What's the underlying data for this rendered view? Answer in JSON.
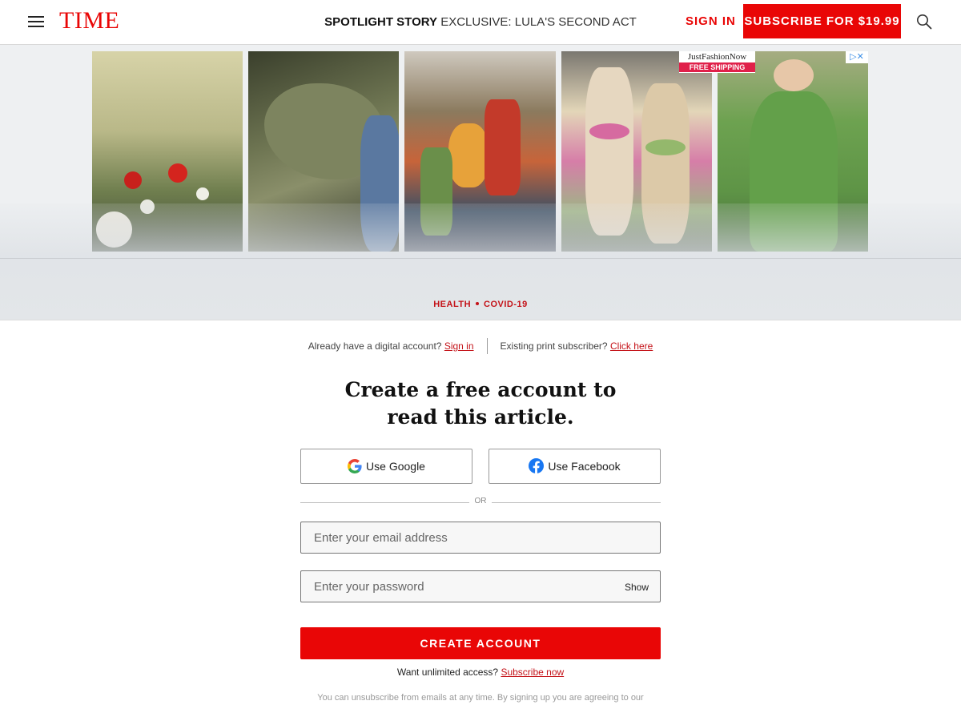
{
  "header": {
    "logo": "TIME",
    "spotlight_label": "SPOTLIGHT STORY",
    "spotlight_title": "EXCLUSIVE: LULA'S SECOND ACT",
    "sign_in": "SIGN IN",
    "subscribe": "SUBSCRIBE FOR $19.99",
    "icons": [
      "menu-icon",
      "search-icon"
    ]
  },
  "ad": {
    "brand": "JustFashionNow",
    "shipping": "FREE SHIPPING",
    "adchoices": "▷✕",
    "tiles": [
      "floral-sweater",
      "green-sneakers",
      "abstract-face-blouse",
      "knit-socks",
      "green-tunic"
    ]
  },
  "article": {
    "tags": [
      "HEALTH",
      "COVID-19"
    ]
  },
  "paywall": {
    "digital_prompt": "Already have a digital account?",
    "digital_link": "Sign in",
    "print_prompt": "Existing print subscriber?",
    "print_link": "Click here",
    "headline_line1": "Create a free account to",
    "headline_line2": "read this article.",
    "google_button": "Use Google",
    "facebook_button": "Use Facebook",
    "or_text": "OR",
    "email_placeholder": "Enter your email address",
    "password_placeholder": "Enter your password",
    "show_label": "Show",
    "create_button": "CREATE ACCOUNT",
    "unlimited_prompt": "Want unlimited access?",
    "unlimited_link": "Subscribe now",
    "legal": "You can unsubscribe from emails at any time. By signing up you are agreeing to our"
  },
  "colors": {
    "brand_red": "#e90606",
    "link_red": "#c41218",
    "facebook_blue": "#1877f2"
  }
}
